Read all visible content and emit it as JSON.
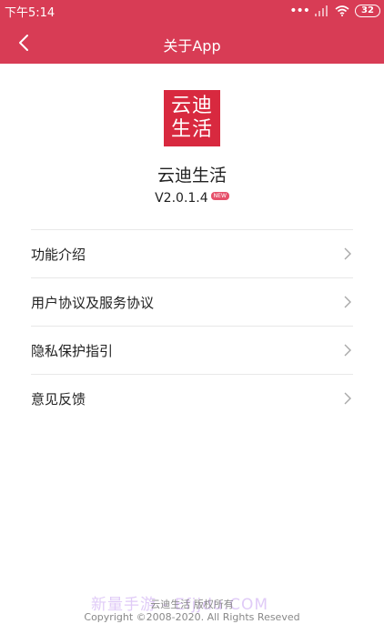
{
  "status_bar": {
    "time": "下午5:14",
    "battery": "32"
  },
  "nav": {
    "title": "关于App"
  },
  "app": {
    "logo_line1": "云迪",
    "logo_line2": "生活",
    "name": "云迪生活",
    "version": "V2.0.1.4",
    "new_badge": "NEW"
  },
  "menu": {
    "items": [
      {
        "label": "功能介绍"
      },
      {
        "label": "用户协议及服务协议"
      },
      {
        "label": "隐私保护指引"
      },
      {
        "label": "意见反馈"
      }
    ]
  },
  "footer": {
    "line1": "云迪生活 版权所有",
    "line2": "Copyright ©2008-2020. All Rights Reseved"
  },
  "watermark": "新量手游 - Efjjdu.COM",
  "colors": {
    "header": "#d83c55",
    "logo": "#d8293f"
  },
  "icons": [
    "back-arrow-icon",
    "signal-icon",
    "wifi-icon",
    "battery-icon",
    "chevron-right-icon"
  ]
}
